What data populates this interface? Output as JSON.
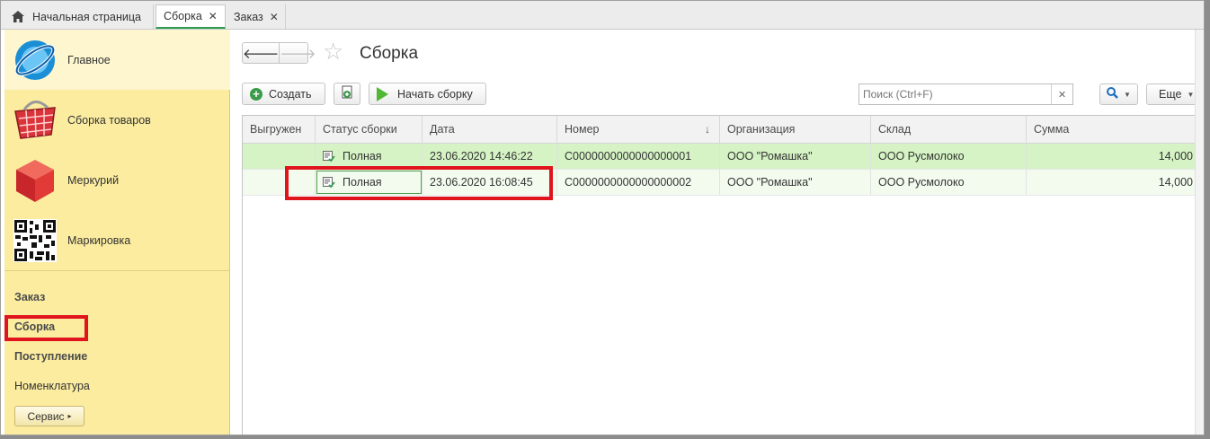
{
  "tabs": [
    {
      "label": "Начальная страница",
      "icon": "home-icon",
      "active": false
    },
    {
      "label": "Сборка",
      "close": "✕",
      "active": true
    },
    {
      "label": "Заказ",
      "close": "✕",
      "active": false
    }
  ],
  "sidebar": {
    "sections": [
      {
        "label": "Главное",
        "icon": "main-logo-icon"
      },
      {
        "label": "Сборка товаров",
        "icon": "basket-icon"
      },
      {
        "label": "Меркурий",
        "icon": "red-cube-icon"
      },
      {
        "label": "Маркировка",
        "icon": "qr-code-icon"
      }
    ],
    "links": [
      {
        "label": "Заказ",
        "bold": true
      },
      {
        "label": "Сборка",
        "bold": true
      },
      {
        "label": "Поступление",
        "bold": true
      },
      {
        "label": "Номенклатура",
        "bold": false
      }
    ],
    "service_button": "Сервис"
  },
  "page": {
    "title": "Сборка",
    "toolbar": {
      "create_label": "Создать",
      "start_label": "Начать сборку",
      "search_placeholder": "Поиск (Ctrl+F)",
      "more_label": "Еще"
    }
  },
  "table": {
    "columns": [
      "Выгружен",
      "Статус сборки",
      "Дата",
      "Номер",
      "Организация",
      "Склад",
      "Сумма"
    ],
    "sort_indicator": "↓",
    "rows": [
      {
        "uploaded": "",
        "status": "Полная",
        "date": "23.06.2020 14:46:22",
        "number": "С0000000000000000001",
        "org": "ООО \"Ромашка\"",
        "warehouse": "ООО Русмолоко",
        "sum": "14,000"
      },
      {
        "uploaded": "",
        "status": "Полная",
        "date": "23.06.2020 16:08:45",
        "number": "С0000000000000000002",
        "org": "ООО \"Ромашка\"",
        "warehouse": "ООО Русмолоко",
        "sum": "14,000"
      }
    ]
  },
  "colors": {
    "sidebar_bg": "#fbeca0",
    "active_tab_underline": "#2e9a50",
    "row_selected": "#d5f3c4",
    "highlight": "#e0141c"
  }
}
